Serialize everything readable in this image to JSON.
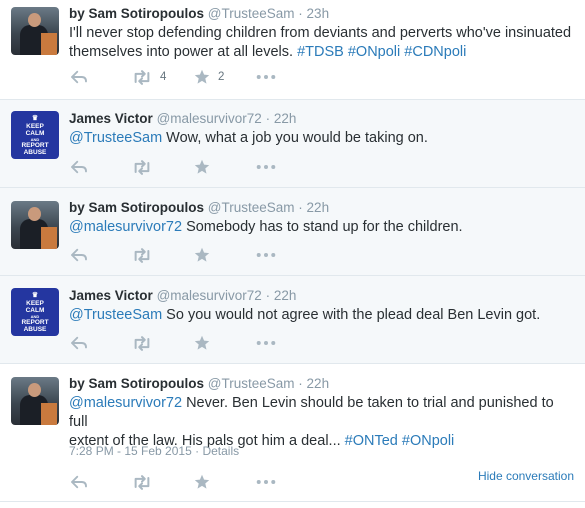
{
  "tweets": [
    {
      "name": "by Sam Sotiropoulos",
      "handle": "@TrusteeSam",
      "time": "23h",
      "text_plain": "I'll never stop defending children from deviants and perverts who've insinuated themselves into power at all levels. ",
      "hashtags": [
        "#TDSB",
        "#ONpoli",
        "#CDNpoli"
      ],
      "retweets": "4",
      "favorites": "2"
    },
    {
      "name": "James Victor",
      "handle": "@malesurvivor72",
      "time": "22h",
      "mention": "@TrusteeSam",
      "text_plain": " Wow, what a job you would be taking on."
    },
    {
      "name": "by Sam Sotiropoulos",
      "handle": "@TrusteeSam",
      "time": "22h",
      "mention": "@malesurvivor72",
      "text_plain": " Somebody has to stand up for the children."
    },
    {
      "name": "James Victor",
      "handle": "@malesurvivor72",
      "time": "22h",
      "mention": "@TrusteeSam",
      "text_plain": " So you would not agree with the plead deal Ben Levin got."
    },
    {
      "name": "by Sam Sotiropoulos",
      "handle": "@TrusteeSam",
      "time": "22h",
      "mention": "@malesurvivor72",
      "text_line1": " Never. Ben Levin should be taken to trial and punished to full",
      "text_line2": "extent of the law. His pals got him a deal... ",
      "hashtags": [
        "#ONTed",
        "#ONpoli"
      ],
      "timestamp": "7:28 PM - 15 Feb 2015",
      "details": "Details",
      "hide_conversation": "Hide conversation"
    }
  ],
  "badge": {
    "crown": "♛",
    "line1": "KEEP",
    "line2": "CALM",
    "line3": "AND",
    "line4": "REPORT",
    "line5": "ABUSE"
  },
  "separator": "·",
  "icons": {
    "reply": "reply-icon",
    "retweet": "retweet-icon",
    "favorite": "star-icon",
    "more": "more-icon"
  },
  "colors": {
    "link": "#2b7bb9",
    "icon": "#aab8c2",
    "muted": "#8899a6",
    "badge_bg": "#2436a0"
  }
}
